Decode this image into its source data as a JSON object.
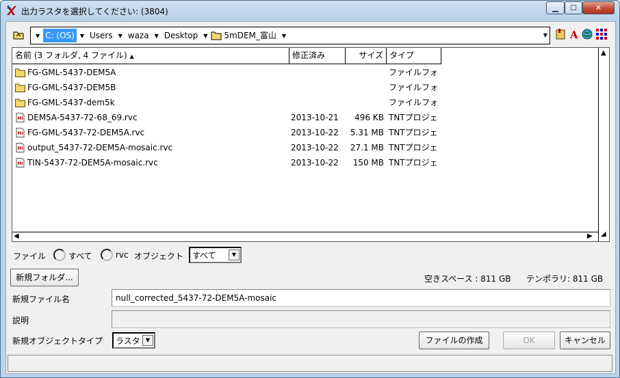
{
  "window": {
    "title": "出力ラスタを選択してください: (3804)",
    "icon": "tnt-app-icon"
  },
  "path": {
    "crumbs": [
      "C: (OS)",
      "Users",
      "waza",
      "Desktop",
      "5mDEM_富山"
    ],
    "selected_index": 0
  },
  "columns": {
    "name": "名前  (3 フォルダ, 4 ファイル)",
    "sort_indicator": "▲",
    "modified": "修正済み",
    "size": "サイズ",
    "type": "タイプ"
  },
  "files": [
    {
      "name": "FG-GML-5437-DEM5A",
      "modified": "",
      "size": "",
      "type": "ファイルフォ",
      "kind": "folder"
    },
    {
      "name": "FG-GML-5437-DEM5B",
      "modified": "",
      "size": "",
      "type": "ファイルフォ",
      "kind": "folder"
    },
    {
      "name": "FG-GML-5437-dem5k",
      "modified": "",
      "size": "",
      "type": "ファイルフォ",
      "kind": "folder"
    },
    {
      "name": "DEM5A-5437-72-68_69.rvc",
      "modified": "2013-10-21",
      "size": "496 KB",
      "type": "TNTプロジェ",
      "kind": "file"
    },
    {
      "name": "FG-GML-5437-72-DEM5A.rvc",
      "modified": "2013-10-22",
      "size": "5.31 MB",
      "type": "TNTプロジェ",
      "kind": "file"
    },
    {
      "name": "output_5437-72-DEM5A-mosaic.rvc",
      "modified": "2013-10-22",
      "size": "27.1 MB",
      "type": "TNTプロジェ",
      "kind": "file"
    },
    {
      "name": "TIN-5437-72-DEM5A-mosaic.rvc",
      "modified": "2013-10-22",
      "size": "150 MB",
      "type": "TNTプロジェ",
      "kind": "file"
    }
  ],
  "filter": {
    "file_label": "ファイル",
    "radio_all": "すべて",
    "radio_rvc": "rvc",
    "object_label": "オブジェクト",
    "object_value": "すべて"
  },
  "new_folder_button": "新規フォルダ...",
  "space": {
    "free": "空きスペース : 811 GB",
    "temp": "テンポラリ: 811 GB"
  },
  "new_file": {
    "label": "新規ファイル名",
    "value": "null_corrected_5437-72-DEM5A-mosaic"
  },
  "description": {
    "label": "説明",
    "value": ""
  },
  "object_type": {
    "label": "新規オブジェクトタイプ",
    "value": "ラスタ"
  },
  "buttons": {
    "create_file": "ファイルの作成",
    "ok": "OK",
    "cancel": "キャンセル"
  },
  "colors": {
    "selection": "#3399ff",
    "folder": "#f6d76b",
    "close": "#c34a33"
  }
}
